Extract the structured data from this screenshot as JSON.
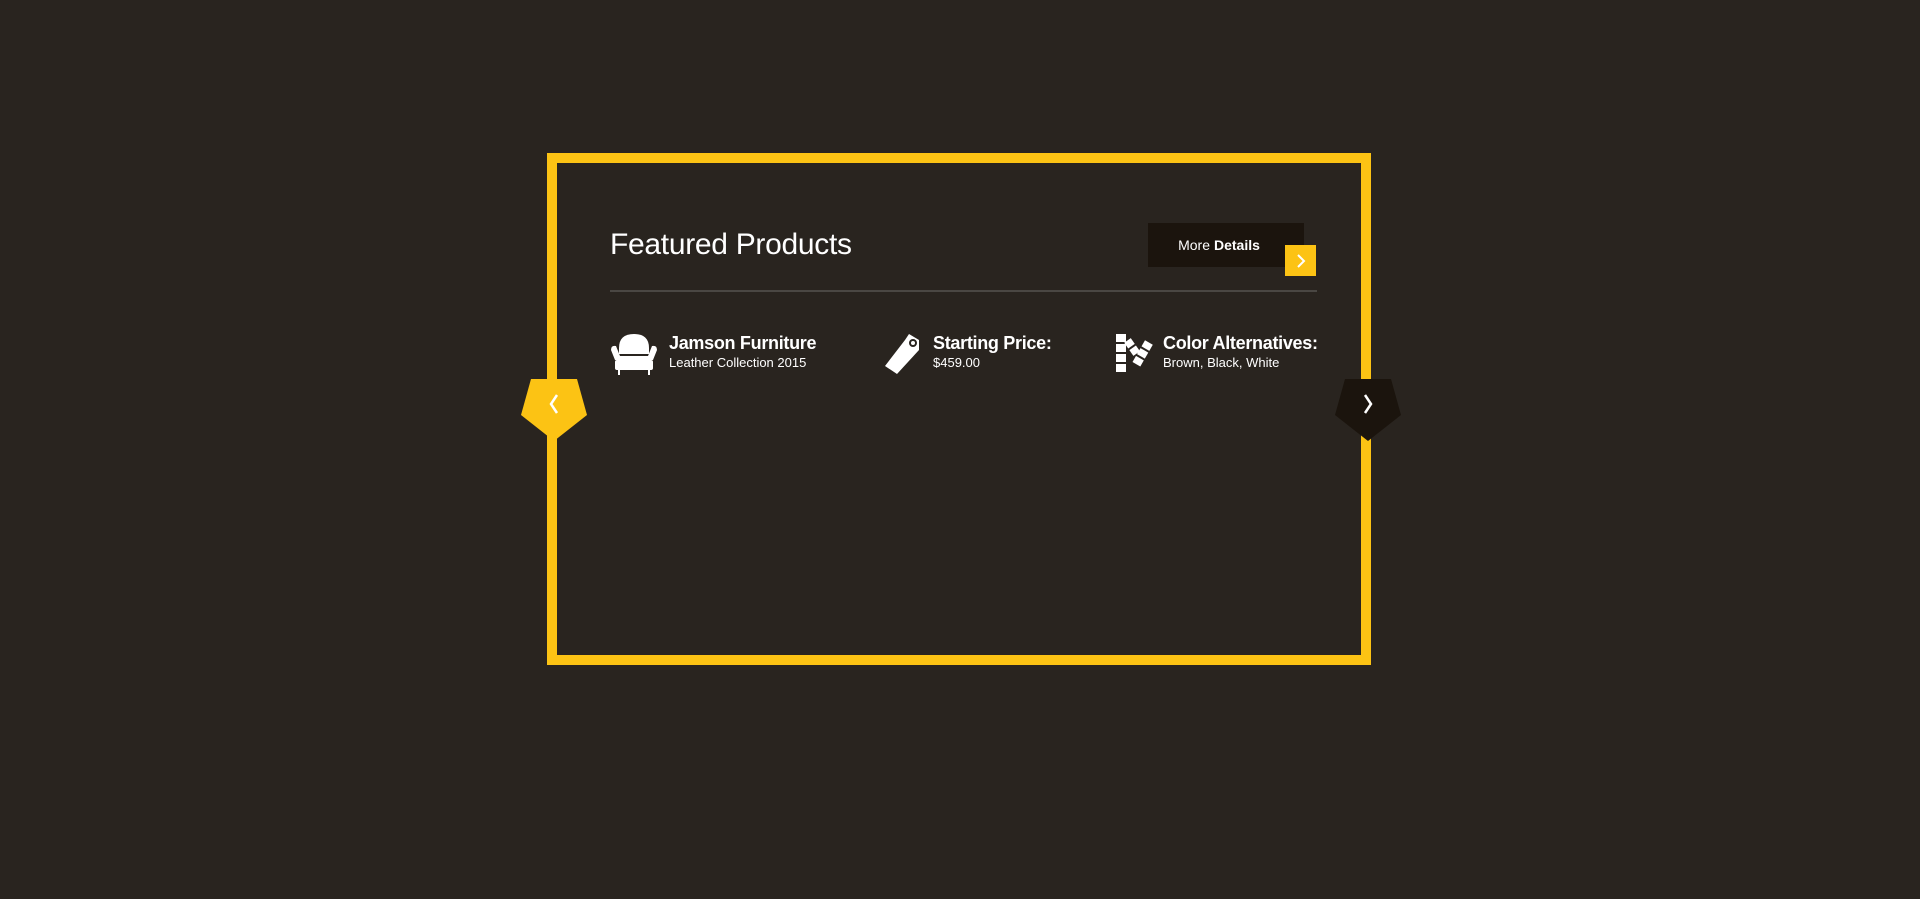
{
  "header": {
    "title": "Featured Products",
    "more_label": "More",
    "more_bold": "Details"
  },
  "features": [
    {
      "icon": "armchair-icon",
      "title": "Jamson Furniture",
      "subtitle": "Leather Collection 2015"
    },
    {
      "icon": "price-tag-icon",
      "title": "Starting Price:",
      "subtitle": "$459.00"
    },
    {
      "icon": "color-swatch-icon",
      "title": "Color Alternatives:",
      "subtitle": "Brown, Black, White"
    }
  ],
  "colors": {
    "accent": "#fcc314",
    "background": "#29241f",
    "dark": "#1b140d"
  }
}
